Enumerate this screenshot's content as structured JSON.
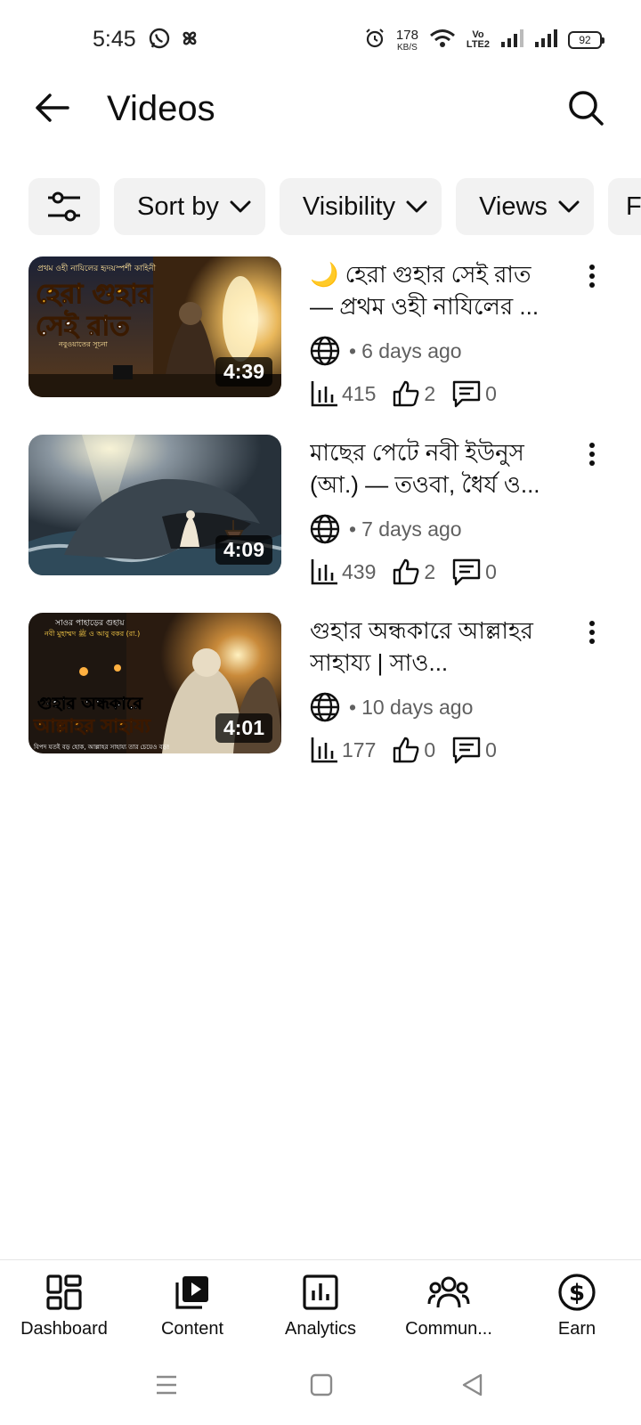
{
  "status_bar": {
    "time": "5:45",
    "speed_value": "178",
    "speed_unit": "KB/S",
    "volte_top": "Vo",
    "volte_bottom": "LTE2",
    "battery": "92"
  },
  "header": {
    "title": "Videos"
  },
  "chips": [
    {
      "label": "Sort by"
    },
    {
      "label": "Visibility"
    },
    {
      "label": "Views"
    },
    {
      "label": "F"
    }
  ],
  "videos": [
    {
      "title": "🌙 হেরা গুহার সেই রাত — প্রথম ওহী নাযিলের ...",
      "duration": "4:39",
      "age": "6 days ago",
      "views": "415",
      "likes": "2",
      "comments": "0",
      "thumb_text_top": "প্রথম ওহী নাযিলের হৃদয়স্পর্শী কাহিনী",
      "thumb_text_big1": "হেরা গুহার",
      "thumb_text_big2": "সেই রাত",
      "thumb_text_sub": "নবুওয়াতের সূচনা"
    },
    {
      "title": "মাছের পেটে নবী ইউনুস (আ.) — তওবা, ধৈর্য ও...",
      "duration": "4:09",
      "age": "7 days ago",
      "views": "439",
      "likes": "2",
      "comments": "0"
    },
    {
      "title": "গুহার অন্ধকারে আল্লাহর সাহায্য | সাও...",
      "duration": "4:01",
      "age": "10 days ago",
      "views": "177",
      "likes": "0",
      "comments": "0",
      "thumb_text_top1": "সাওর পাহাড়ের গুহায়",
      "thumb_text_top2": "নবী মুহাম্মদ ﷺ ও আবু বকর (রা.)",
      "thumb_text_big1": "গুহার অন্ধকারে",
      "thumb_text_big2": "আল্লাহর সাহায্য",
      "thumb_text_bottom": "বিপদ যতই বড় হোক, আল্লাহর সাহায্য তার চেয়েও বড়!"
    }
  ],
  "bottom_nav": [
    {
      "label": "Dashboard",
      "icon": "dashboard-icon"
    },
    {
      "label": "Content",
      "icon": "content-icon"
    },
    {
      "label": "Analytics",
      "icon": "analytics-icon"
    },
    {
      "label": "Commun...",
      "icon": "community-icon"
    },
    {
      "label": "Earn",
      "icon": "earn-icon"
    }
  ],
  "colors": {
    "chip_bg": "#f2f2f2",
    "text_primary": "#0f0f0f",
    "text_secondary": "#606060"
  }
}
